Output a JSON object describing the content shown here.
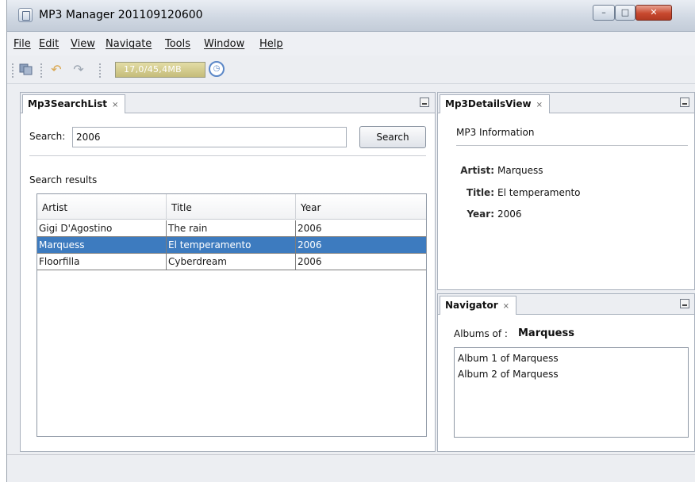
{
  "window": {
    "title": "MP3 Manager 201109120600",
    "controls": {
      "minimize": "–",
      "maximize": "□",
      "close": "✕"
    }
  },
  "menu": [
    "File",
    "Edit",
    "View",
    "Navigate",
    "Tools",
    "Window",
    "Help"
  ],
  "toolbar": {
    "memory": "17,0/45,4MB",
    "icons": [
      "save-all-icon",
      "undo-icon",
      "redo-icon",
      "garbage-collect-icon"
    ]
  },
  "search_panel": {
    "tab": "Mp3SearchList",
    "search_label": "Search:",
    "search_value": "2006",
    "search_button": "Search",
    "results_label": "Search results",
    "columns": [
      "Artist",
      "Title",
      "Year"
    ],
    "rows": [
      {
        "artist": "Gigi D'Agostino",
        "title": "The rain",
        "year": "2006"
      },
      {
        "artist": "Marquess",
        "title": "El temperamento",
        "year": "2006"
      },
      {
        "artist": "Floorfilla",
        "title": "Cyberdream",
        "year": "2006"
      }
    ],
    "selected_row": 1
  },
  "details_panel": {
    "tab": "Mp3DetailsView",
    "heading": "MP3 Information",
    "artist_key": "Artist:",
    "artist": "Marquess",
    "title_key": "Title:",
    "title": "El temperamento",
    "year_key": "Year:",
    "year": "2006"
  },
  "navigator_panel": {
    "tab": "Navigator",
    "albums_label": "Albums of :",
    "albums_artist": "Marquess",
    "albums": [
      "Album 1 of Marquess",
      "Album 2 of Marquess"
    ]
  },
  "colors": {
    "selection": "#3d7bbf",
    "memory_bar": "#c5bc79"
  }
}
